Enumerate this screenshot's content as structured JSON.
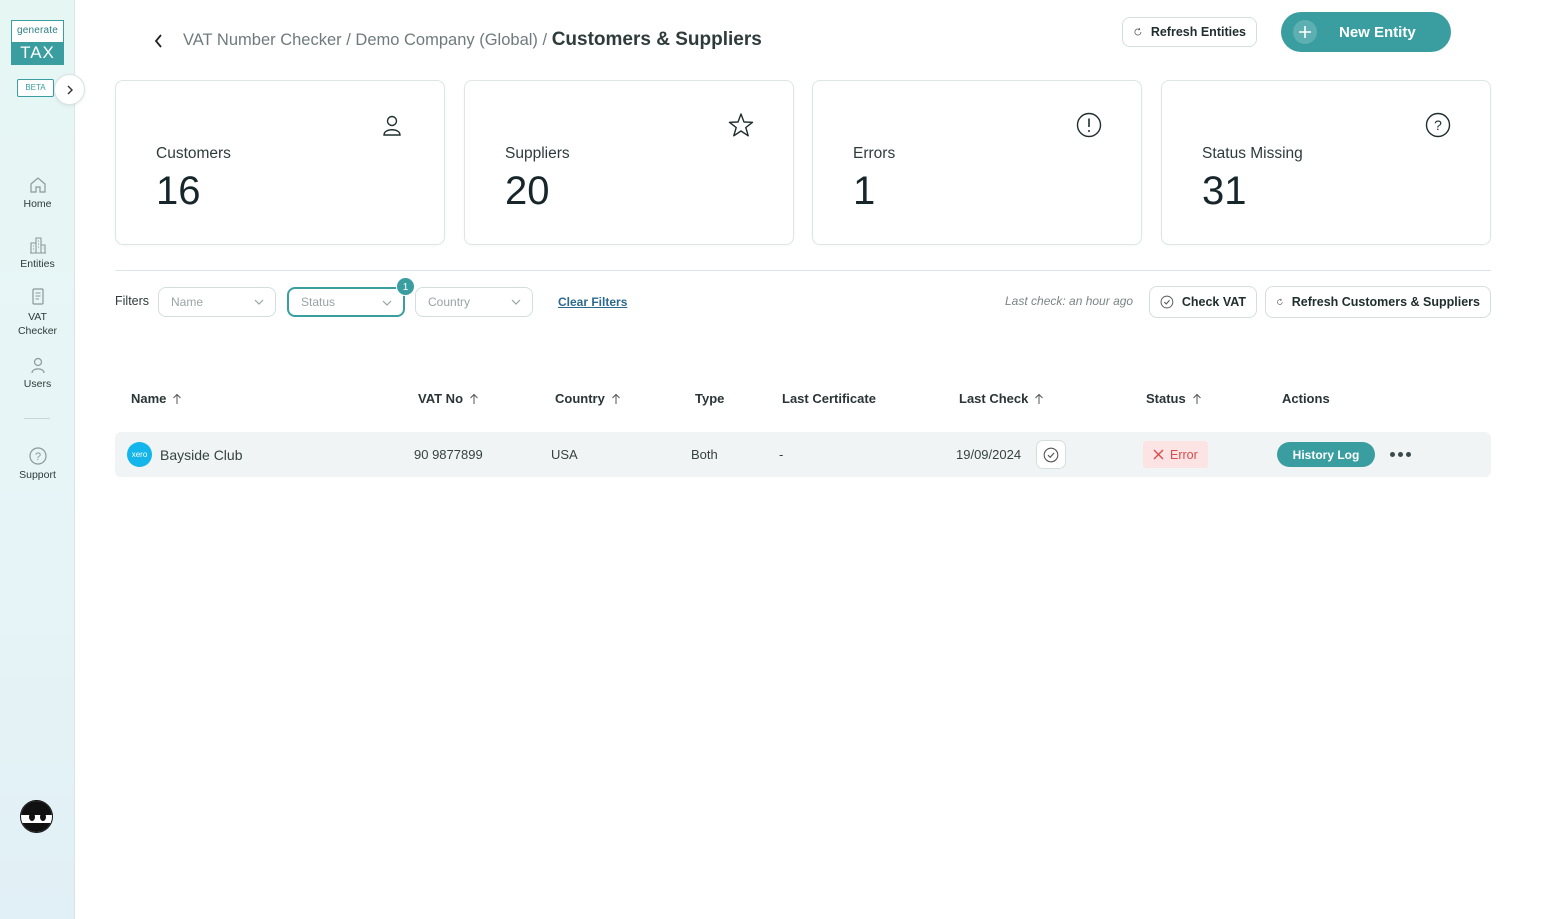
{
  "sidebar": {
    "logo_top": "generate",
    "logo_bottom": "TAX",
    "beta": "BETA",
    "items": [
      {
        "label": "Home",
        "icon": "home-icon"
      },
      {
        "label": "Entities",
        "icon": "buildings-icon"
      },
      {
        "label": "VAT Checker",
        "icon": "document-icon"
      },
      {
        "label": "Users",
        "icon": "user-icon"
      },
      {
        "label": "Support",
        "icon": "help-icon"
      }
    ]
  },
  "header": {
    "crumb1": "VAT Number Checker",
    "crumb2": "Demo Company (Global)",
    "current": "Customers & Suppliers",
    "separator": "/",
    "refresh_entities": "Refresh Entities",
    "new_entity": "New Entity"
  },
  "stats": [
    {
      "label": "Customers",
      "value": "16",
      "icon": "user-icon"
    },
    {
      "label": "Suppliers",
      "value": "20",
      "icon": "star-icon"
    },
    {
      "label": "Errors",
      "value": "1",
      "icon": "exclamation-icon"
    },
    {
      "label": "Status Missing",
      "value": "31",
      "icon": "question-icon"
    }
  ],
  "filters": {
    "label": "Filters",
    "name_placeholder": "Name",
    "status_placeholder": "Status",
    "country_placeholder": "Country",
    "status_badge": "1",
    "clear": "Clear Filters",
    "last_check": "Last check: an hour ago",
    "check_vat": "Check VAT",
    "refresh_cs": "Refresh Customers & Suppliers"
  },
  "table": {
    "columns": [
      "Name",
      "VAT No",
      "Country",
      "Type",
      "Last Certificate",
      "Last Check",
      "Status",
      "Actions"
    ],
    "rows": [
      {
        "source_badge": "xero",
        "name": "Bayside Club",
        "vat_no": "90 9877899",
        "country": "USA",
        "type": "Both",
        "last_certificate": "-",
        "last_check": "19/09/2024",
        "status": "Error",
        "action": "History Log"
      }
    ]
  },
  "colors": {
    "accent": "#3a9ea0",
    "error_bg": "#fde4e4",
    "error_text": "#d84c4c"
  }
}
